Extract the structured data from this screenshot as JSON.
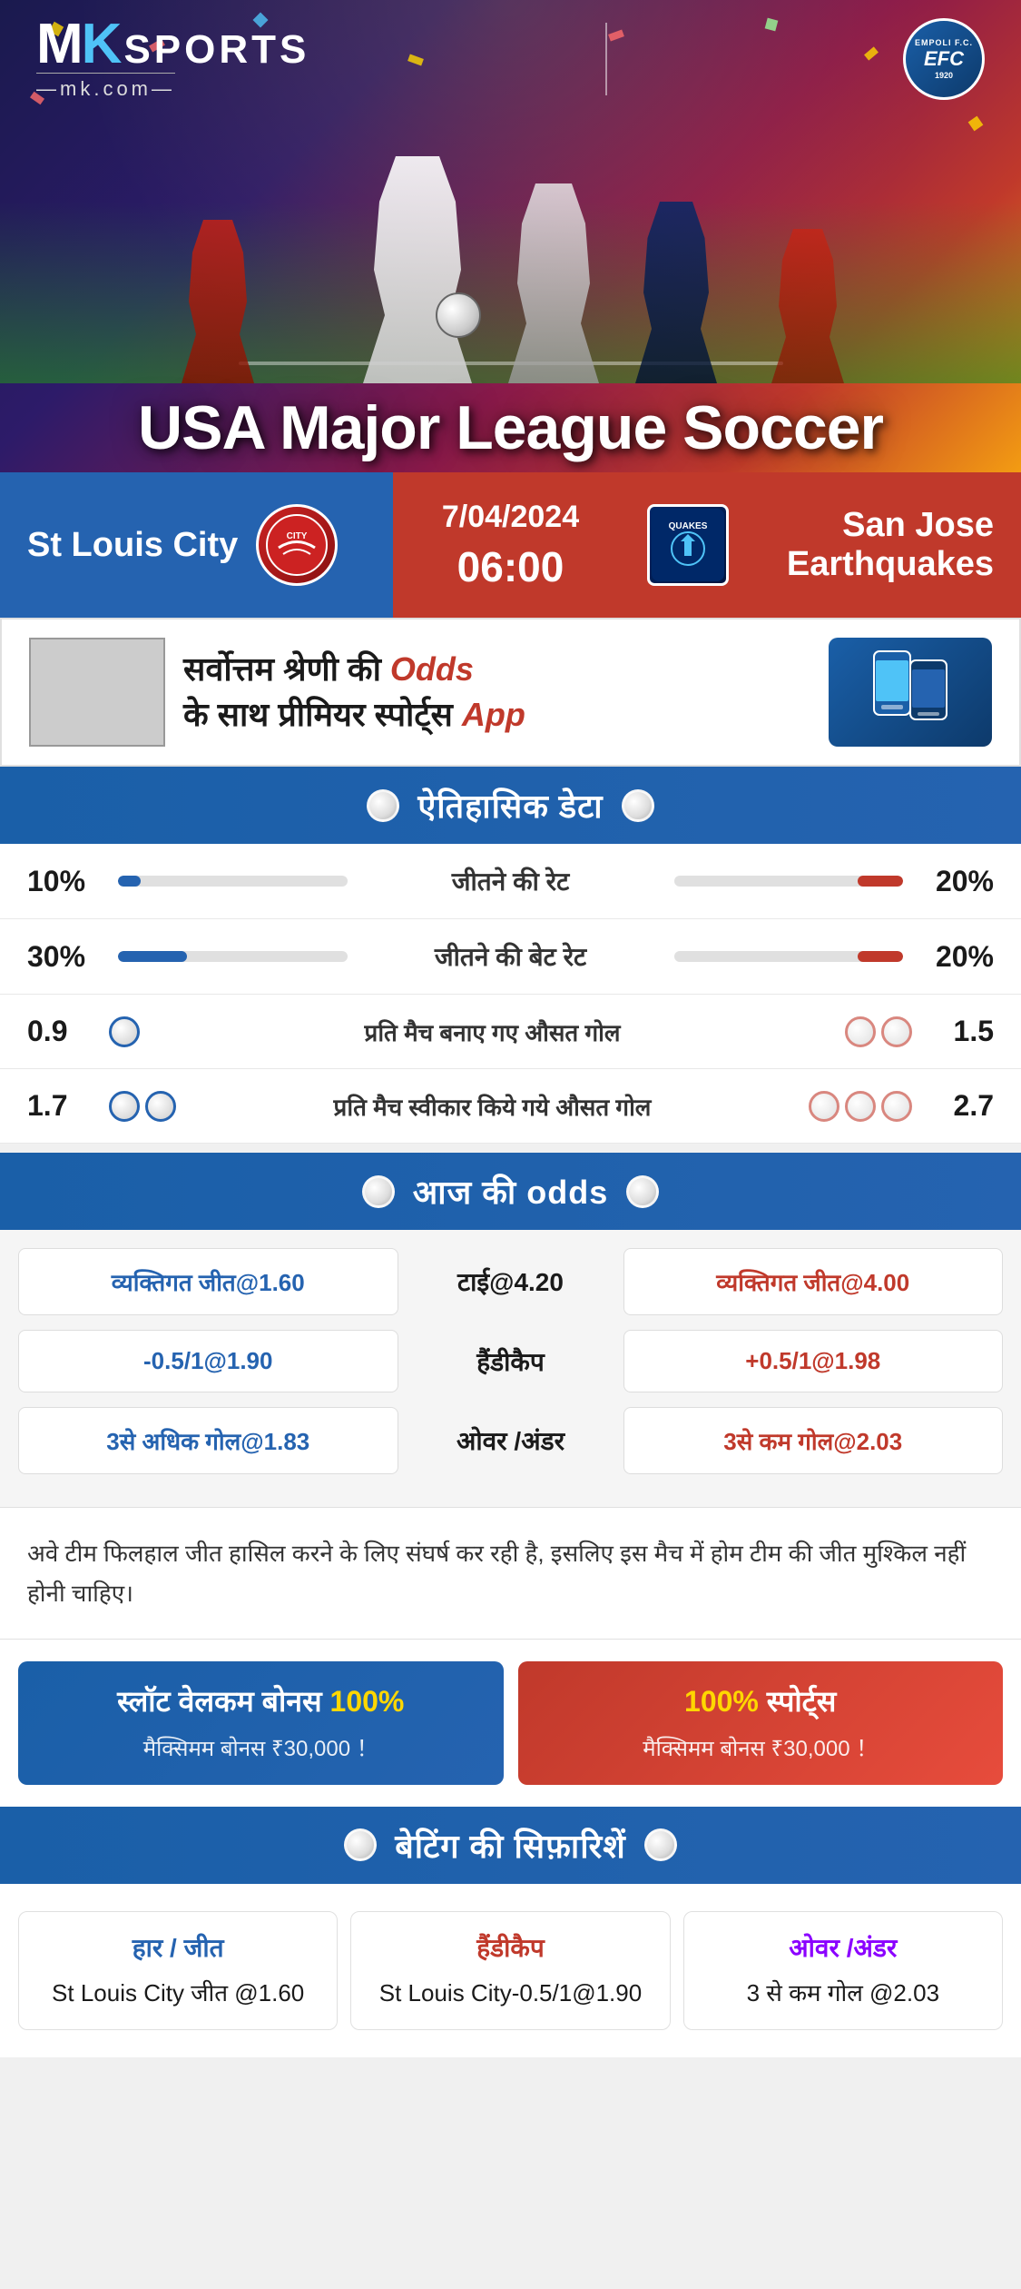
{
  "header": {
    "logo": {
      "mk": "MK",
      "sports": "SPORTS",
      "domain": "—mk.com—"
    },
    "empoli": {
      "line1": "EMPOLI F.C.",
      "fc": "EFC",
      "year": "1920"
    },
    "league_title": "USA Major League Soccer"
  },
  "match": {
    "team_left": "St Louis City",
    "team_right": "San Jose Earthquakes",
    "date": "7/04/2024",
    "time": "06:00",
    "team_left_abbr": "CITY",
    "team_right_abbr": "QUAKES"
  },
  "promo": {
    "text": "सर्वोत्तम श्रेणी की",
    "bold": "Odds",
    "text2": "के साथ प्रीमियर स्पोर्ट्स",
    "app": "App"
  },
  "historical": {
    "section_title": "ऐतिहासिक डेटा",
    "stats": [
      {
        "label": "जीतने की रेट",
        "left_value": "10%",
        "right_value": "20%",
        "left_pct": 10,
        "right_pct": 20
      },
      {
        "label": "जीतने की बेट रेट",
        "left_value": "30%",
        "right_value": "20%",
        "left_pct": 30,
        "right_pct": 20
      }
    ],
    "goal_stats": [
      {
        "label": "प्रति मैच बनाए गए औसत गोल",
        "left_value": "0.9",
        "right_value": "1.5",
        "left_balls": 1,
        "right_balls": 2
      },
      {
        "label": "प्रति मैच स्वीकार किये गये औसत गोल",
        "left_value": "1.7",
        "right_value": "2.7",
        "left_balls": 2,
        "right_balls": 3
      }
    ]
  },
  "odds": {
    "section_title": "आज की odds",
    "rows": [
      {
        "left": "व्यक्तिगत जीत@1.60",
        "center": "टाई@4.20",
        "right": "व्यक्तिगत जीत@4.00"
      },
      {
        "left": "-0.5/1@1.90",
        "center": "हैंडीकैप",
        "right": "+0.5/1@1.98"
      },
      {
        "left": "3से अधिक गोल@1.83",
        "center": "ओवर /अंडर",
        "right": "3से कम गोल@2.03"
      }
    ]
  },
  "analysis": {
    "text": "अवे टीम फिलहाल जीत हासिल करने के लिए संघर्ष कर रही है, इसलिए इस मैच में होम टीम की जीत मुश्किल नहीं होनी चाहिए।"
  },
  "bonus": {
    "left": {
      "title": "स्लॉट वेलकम बोनस",
      "highlight": "100%",
      "subtitle": "मैक्सिमम बोनस ₹30,000  ！"
    },
    "right": {
      "title": "100%स्पोर्ट्स",
      "subtitle": "मैक्सिमम बोनस  ₹30,000 ！"
    }
  },
  "betting_rec": {
    "section_title": "बेटिंग की सिफ़ारिशें",
    "cards": [
      {
        "title": "हार / जीत",
        "value": "St Louis City जीत @1.60"
      },
      {
        "title": "हैंडीकैप",
        "value": "St Louis City-0.5/1@1.90"
      },
      {
        "title": "ओवर /अंडर",
        "value": "3 से कम गोल @2.03"
      }
    ]
  }
}
